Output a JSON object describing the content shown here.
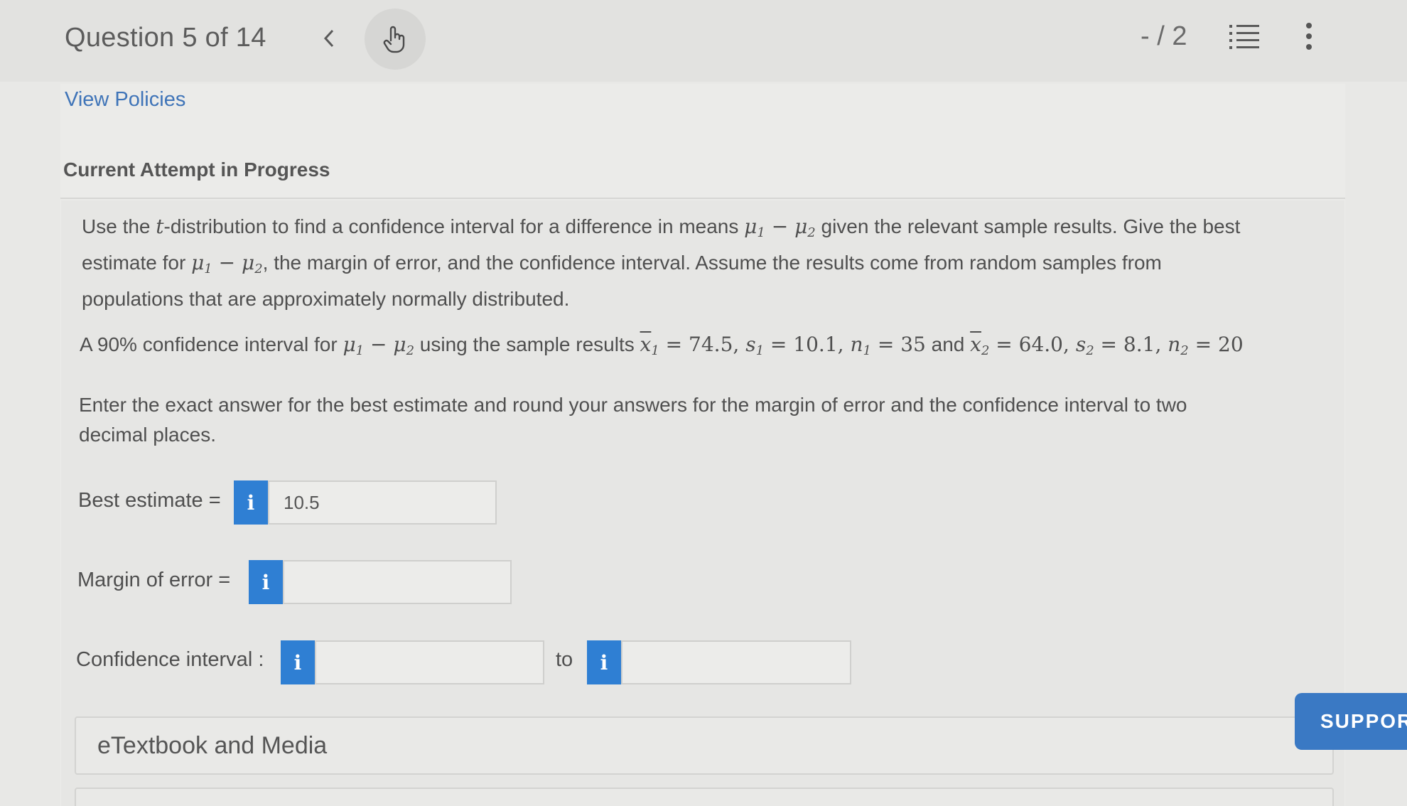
{
  "header": {
    "question_title": "Question 5 of 14",
    "score": "- / 2",
    "icons": {
      "prev": "chevron-left-icon",
      "hand": "hand-pointer-icon",
      "list": "numbered-list-icon",
      "more": "more-vertical-icon"
    }
  },
  "policies": {
    "link": "View Policies"
  },
  "attempt": {
    "title": "Current Attempt in Progress"
  },
  "question": {
    "intro_a": "Use the ",
    "intro_t": "t",
    "intro_b": "-distribution to find a confidence interval for a difference in means ",
    "intro_c": " given the relevant sample results. Give the best",
    "intro_d": "estimate for ",
    "intro_e": ", the margin of error, and the confidence interval. Assume the results come from random samples from",
    "intro_f": "populations that are approximately normally distributed.",
    "setup_a": "A 90% confidence interval for ",
    "setup_b": " using the sample results ",
    "setup_and": " and ",
    "values": {
      "x1": "74.5",
      "s1": "10.1",
      "n1": "35",
      "x2": "64.0",
      "s2": "8.1",
      "n2": "20"
    },
    "instruction_1": "Enter the exact answer for the best estimate and round your answers for the margin of error and the confidence interval to two",
    "instruction_2": "decimal places."
  },
  "form": {
    "best_estimate_label": "Best estimate =",
    "best_estimate_value": "10.5",
    "margin_label": "Margin of error =",
    "margin_value": "",
    "ci_label": "Confidence interval :",
    "ci_low_value": "",
    "ci_to": "to",
    "ci_high_value": "",
    "info_glyph": "i"
  },
  "etextbook": {
    "label": "eTextbook and Media"
  },
  "support": {
    "label": "SUPPORT",
    "icon": "chat-bubble-icon"
  },
  "colors": {
    "accent": "#2f7fd3",
    "link": "#3f74b8",
    "support": "#3a79c4"
  }
}
